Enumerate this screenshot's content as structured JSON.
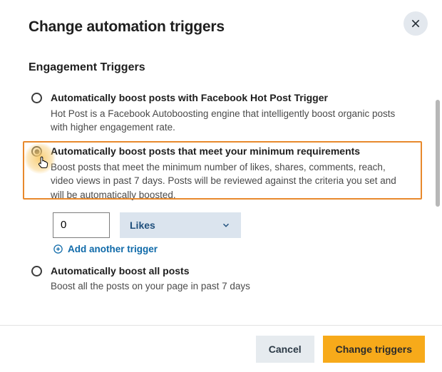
{
  "modal": {
    "title": "Change automation triggers",
    "section": "Engagement Triggers"
  },
  "options": {
    "hot": {
      "title": "Automatically boost posts with Facebook Hot Post Trigger",
      "desc": "Hot Post is a Facebook Autoboosting engine that intelligently boost organic posts with higher engagement rate."
    },
    "min": {
      "title": "Automatically boost posts that meet your minimum requirements",
      "desc": "Boost posts that meet the minimum number of likes, shares, comments, reach, video views in past 7 days. Posts will be reviewed against the criteria you set and will be automatically boosted."
    },
    "all": {
      "title": "Automatically boost all posts",
      "desc": "Boost all the posts on your page in past 7 days"
    }
  },
  "trigger": {
    "value": "0",
    "metric": "Likes",
    "add_label": "Add another trigger"
  },
  "footer": {
    "cancel": "Cancel",
    "submit": "Change triggers"
  }
}
